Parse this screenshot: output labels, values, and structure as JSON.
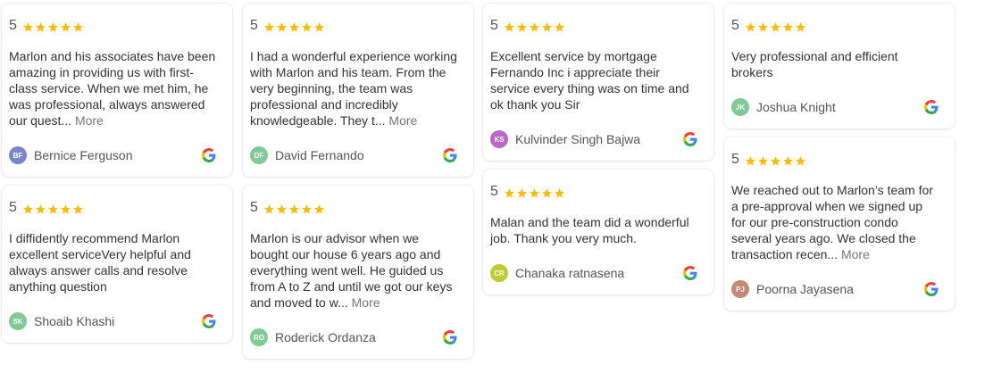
{
  "more_label": "More",
  "stars_color": "#FBBC04",
  "reviews": [
    {
      "rating": "5",
      "text": "Marlon and his associates have been amazing in providing us with first-class service. When we met him, he was professional, always answered our quest...",
      "has_more": true,
      "initials": "BF",
      "author": "Bernice Ferguson",
      "avatar_color": "#7986cb"
    },
    {
      "rating": "5",
      "text": "I diffidently recommend Marlon excellent serviceVery helpful and always answer calls and resolve anything question",
      "has_more": false,
      "initials": "SK",
      "author": "Shoaib Khashi",
      "avatar_color": "#81c995"
    },
    {
      "rating": "5",
      "text": "I had a wonderful experience working with Marlon and his team. From the very beginning, the team was professional and incredibly knowledgeable. They t...",
      "has_more": true,
      "initials": "DF",
      "author": "David Fernando",
      "avatar_color": "#81c995"
    },
    {
      "rating": "5",
      "text": "Marlon is our advisor when we bought our house 6 years ago and everything went well. He guided us from A to Z and until we got our keys and moved to w...",
      "has_more": true,
      "initials": "RO",
      "author": "Roderick Ordanza",
      "avatar_color": "#81c995"
    },
    {
      "rating": "5",
      "text": "Excellent service by mortgage Fernando Inc i appreciate their service every thing was on time and ok thank you Sir",
      "has_more": false,
      "initials": "KS",
      "author": "Kulvinder Singh Bajwa",
      "avatar_color": "#ba68c8"
    },
    {
      "rating": "5",
      "text": "Malan and the team did a wonderful job. Thank you very much.",
      "has_more": false,
      "initials": "CR",
      "author": "Chanaka ratnasena",
      "avatar_color": "#c0ca33"
    },
    {
      "rating": "5",
      "text": "Very professional and efficient brokers",
      "has_more": false,
      "initials": "JK",
      "author": "Joshua Knight",
      "avatar_color": "#81c995"
    },
    {
      "rating": "5",
      "text": "We reached out to Marlon’s team for a pre-approval when we signed up for our pre-construction condo several years ago. We closed the transaction recen...",
      "has_more": true,
      "initials": "PJ",
      "author": "Poorna Jayasena",
      "avatar_color": "#c48b72"
    }
  ]
}
